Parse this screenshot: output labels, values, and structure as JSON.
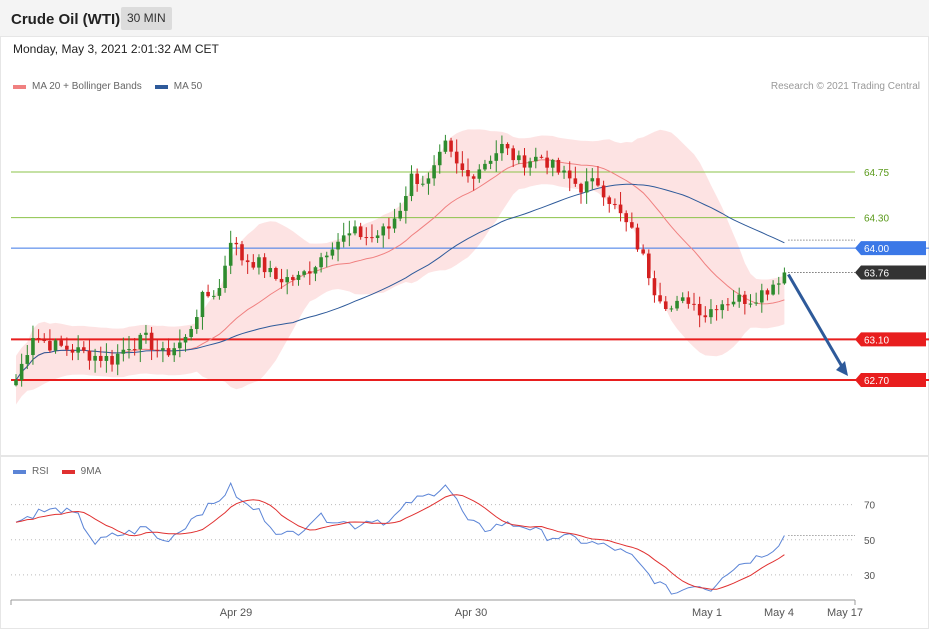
{
  "header": {
    "title": "Crude Oil (WTI)",
    "timeframe": "30 MIN",
    "timestamp": "Monday, May 3, 2021 2:01:32 AM CET",
    "copyright": "Research © 2021 Trading Central"
  },
  "legend_main": [
    {
      "label": "MA 20 + Bollinger Bands",
      "color": "#f08080"
    },
    {
      "label": "MA 50",
      "color": "#2e5a9a"
    }
  ],
  "legend_rsi": [
    {
      "label": "RSI",
      "color": "#5b84d6"
    },
    {
      "label": "9MA",
      "color": "#e03030"
    }
  ],
  "colors": {
    "bull": "#2e8b2e",
    "bear": "#d42020",
    "bollinger_fill": "#fde0e0",
    "ma20": "#f08080",
    "ma50": "#2e5a9a",
    "resistance": "#8bc34a",
    "pivot": "#3b78e7",
    "support": "#e81e1e",
    "arrow": "#2e5a9a",
    "last": "#333333"
  },
  "chart_data": {
    "type": "candlestick",
    "title": "Crude Oil (WTI)",
    "timeframe": "30 MIN",
    "x_ticks": [
      "Apr 29",
      "Apr 30",
      "May 1",
      "May 4",
      "May 17"
    ],
    "price_range": [
      62.4,
      65.2
    ],
    "levels": [
      {
        "label": "64.75",
        "value": 64.75,
        "kind": "resistance"
      },
      {
        "label": "64.30",
        "value": 64.3,
        "kind": "resistance"
      },
      {
        "label": "64.00",
        "value": 64.0,
        "kind": "pivot"
      },
      {
        "label": "63.76",
        "value": 63.76,
        "kind": "last"
      },
      {
        "label": "63.10",
        "value": 63.1,
        "kind": "support"
      },
      {
        "label": "62.70",
        "value": 62.7,
        "kind": "support"
      }
    ],
    "forecast_arrow": {
      "from": 63.76,
      "to": 62.7
    },
    "anchors": [
      [
        0,
        62.7
      ],
      [
        3,
        63.15
      ],
      [
        6,
        63.05
      ],
      [
        10,
        63.0
      ],
      [
        13,
        62.95
      ],
      [
        17,
        62.9
      ],
      [
        20,
        63.05
      ],
      [
        23,
        63.1
      ],
      [
        26,
        62.95
      ],
      [
        30,
        63.1
      ],
      [
        33,
        63.5
      ],
      [
        36,
        63.6
      ],
      [
        38,
        64.1
      ],
      [
        40,
        63.9
      ],
      [
        43,
        63.85
      ],
      [
        46,
        63.7
      ],
      [
        50,
        63.7
      ],
      [
        53,
        63.85
      ],
      [
        56,
        64.05
      ],
      [
        60,
        64.15
      ],
      [
        63,
        64.1
      ],
      [
        66,
        64.2
      ],
      [
        68,
        64.4
      ],
      [
        70,
        64.7
      ],
      [
        73,
        64.65
      ],
      [
        76,
        65.0
      ],
      [
        78,
        64.8
      ],
      [
        80,
        64.7
      ],
      [
        83,
        64.85
      ],
      [
        86,
        65.0
      ],
      [
        89,
        64.85
      ],
      [
        93,
        64.9
      ],
      [
        96,
        64.75
      ],
      [
        100,
        64.6
      ],
      [
        103,
        64.65
      ],
      [
        106,
        64.4
      ],
      [
        109,
        64.15
      ],
      [
        111,
        63.9
      ],
      [
        113,
        63.6
      ],
      [
        116,
        63.4
      ],
      [
        119,
        63.5
      ],
      [
        122,
        63.35
      ],
      [
        124,
        63.45
      ],
      [
        127,
        63.5
      ],
      [
        130,
        63.5
      ],
      [
        133,
        63.6
      ],
      [
        136,
        63.76
      ]
    ],
    "rsi_ticks": [
      70,
      50,
      30
    ],
    "rsi_range": [
      18,
      84
    ],
    "rsi_anchors": [
      [
        0,
        60
      ],
      [
        4,
        66
      ],
      [
        8,
        67
      ],
      [
        11,
        63
      ],
      [
        14,
        48
      ],
      [
        17,
        52
      ],
      [
        20,
        54
      ],
      [
        23,
        57
      ],
      [
        26,
        49
      ],
      [
        29,
        55
      ],
      [
        32,
        65
      ],
      [
        35,
        70
      ],
      [
        38,
        80
      ],
      [
        40,
        71
      ],
      [
        43,
        66
      ],
      [
        47,
        52
      ],
      [
        50,
        55
      ],
      [
        53,
        63
      ],
      [
        56,
        62
      ],
      [
        60,
        58
      ],
      [
        63,
        62
      ],
      [
        66,
        60
      ],
      [
        68,
        66
      ],
      [
        70,
        72
      ],
      [
        73,
        75
      ],
      [
        76,
        82
      ],
      [
        78,
        72
      ],
      [
        80,
        60
      ],
      [
        83,
        56
      ],
      [
        86,
        59
      ],
      [
        90,
        58
      ],
      [
        94,
        52
      ],
      [
        98,
        51
      ],
      [
        102,
        48
      ],
      [
        106,
        45
      ],
      [
        109,
        40
      ],
      [
        112,
        30
      ],
      [
        115,
        22
      ],
      [
        117,
        20
      ],
      [
        120,
        25
      ],
      [
        123,
        22
      ],
      [
        125,
        30
      ],
      [
        128,
        36
      ],
      [
        131,
        40
      ],
      [
        134,
        45
      ],
      [
        136,
        52
      ]
    ]
  }
}
